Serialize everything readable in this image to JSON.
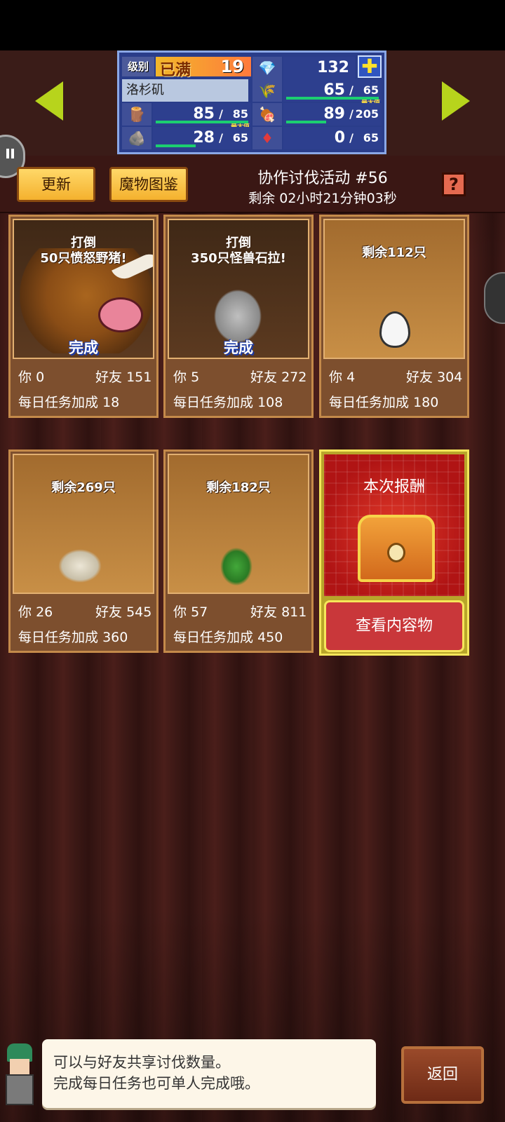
{
  "header": {
    "level_label": "级别",
    "level_full": "已满",
    "level_value": "19",
    "gems": "132",
    "town_name": "洛杉矶",
    "resources": {
      "wood": {
        "current": "85",
        "max": "85",
        "max_tag": "最大值"
      },
      "grass": {
        "current": "65",
        "max": "65",
        "max_tag": "最大值"
      },
      "food": {
        "current": "89",
        "max": "205"
      },
      "stone": {
        "current": "28",
        "max": "65"
      },
      "ruby": {
        "current": "0",
        "max": "65"
      }
    }
  },
  "toolbar": {
    "refresh_label": "更新",
    "bestiary_label": "魔物图鉴",
    "event_title": "协作讨伐活动 #56",
    "event_time": "剩余 02小时21分钟03秒",
    "help_label": "?"
  },
  "cards": [
    {
      "task": "打倒\n50只愤怒野猪!",
      "status": "完成",
      "you_label": "你",
      "you": "0",
      "friend_label": "好友",
      "friend": "151",
      "bonus_label": "每日任务加成",
      "bonus": "18"
    },
    {
      "task": "打倒\n350只怪兽石拉!",
      "status": "完成",
      "you_label": "你",
      "you": "5",
      "friend_label": "好友",
      "friend": "272",
      "bonus_label": "每日任务加成",
      "bonus": "108"
    },
    {
      "task": "剩余112只",
      "status": "",
      "you_label": "你",
      "you": "4",
      "friend_label": "好友",
      "friend": "304",
      "bonus_label": "每日任务加成",
      "bonus": "180"
    },
    {
      "task": "剩余269只",
      "status": "",
      "you_label": "你",
      "you": "26",
      "friend_label": "好友",
      "friend": "545",
      "bonus_label": "每日任务加成",
      "bonus": "360"
    },
    {
      "task": "剩余182只",
      "status": "",
      "you_label": "你",
      "you": "57",
      "friend_label": "好友",
      "friend": "811",
      "bonus_label": "每日任务加成",
      "bonus": "450"
    }
  ],
  "reward": {
    "title": "本次报酬",
    "view_label": "查看内容物"
  },
  "dialog": {
    "line1": "可以与好友共享讨伐数量。",
    "line2": "完成每日任务也可单人完成哦。"
  },
  "back_label": "返回",
  "icons": {
    "gem": "diamond-icon",
    "plus": "plus-icon",
    "wood": "log-icon",
    "grass": "grass-icon",
    "food": "meat-icon",
    "stone": "stone-icon",
    "ruby": "ruby-icon"
  },
  "colors": {
    "accent_arrow": "#b7d41c",
    "stat_panel": "#2a3d8a",
    "card_done_text": "#1b3aa8",
    "reward_red": "#c9373a"
  },
  "progress": {
    "wood": 1.0,
    "grass": 1.0,
    "food": 0.43,
    "stone": 0.43,
    "ruby": 0.0
  }
}
